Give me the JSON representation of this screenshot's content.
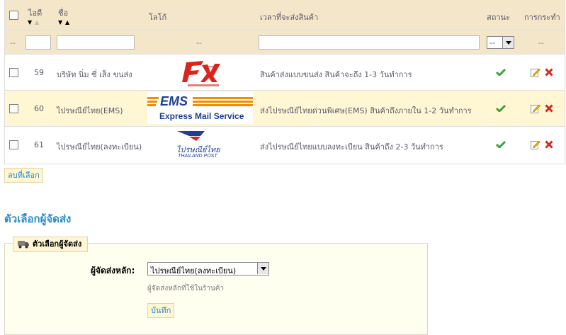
{
  "table": {
    "headers": {
      "id": "ไอดี",
      "name": "ชื่อ",
      "logo": "โลโก้",
      "delay": "เวลาที่จะส่งสินค้า",
      "status": "สถานะ",
      "actions": "การกระทำ"
    },
    "filter": {
      "first_dash": "--",
      "logo_dash": "--",
      "status_select": "--",
      "actions_dash": "--"
    },
    "rows": [
      {
        "id": "59",
        "name": "บริษัท นิ่ม ซี่ เส็ง ขนส่ง",
        "logo": "nim-see-seng-logo",
        "delay": "สินค้าส่งแบบขนส่ง สินค้าจะถึง 1-3 วันทำการ",
        "status": "active"
      },
      {
        "id": "60",
        "name": "ไปรษณีย์ไทย(EMS)",
        "logo_text_top": "EMS",
        "logo_text_bottom": "Express Mail Service",
        "delay": "ส่งไปรษณีย์ไทยด่วนพิเศษ(EMS) สินค้าถึงภายใน 1-2 วันทำการ",
        "status": "active"
      },
      {
        "id": "61",
        "name": "ไปรษณีย์ไทย(ลงทะเบียน)",
        "logo_text_top": "ไปรษณีย์ไทย",
        "logo_text_bottom": "THAILAND POST",
        "delay": "ส่งไปรษณีย์ไทยแบบลงทะเบียน สินค้าถึง 2-3 วันทำการ",
        "status": "active"
      }
    ],
    "delete_selected": "ลบที่เลือก"
  },
  "options": {
    "section_title": "ตัวเลือกผู้จัดส่ง",
    "legend": "ตัวเลือกผู้จัดส่ง",
    "default_carrier_label": "ผู้จัดส่งหลัก:",
    "default_carrier_value": "ไปรษณีย์ไทย(ลงทะเบียน)",
    "hint": "ผู้จัดส่งหลักที่ใช้ในร้านค้า",
    "save": "บันทึก"
  },
  "colors": {
    "header_bg": "#f4e6c9",
    "highlight_row": "#fff6d3",
    "link_blue": "#268ccd",
    "check_green": "#3fa33f",
    "delete_red": "#d9251d"
  }
}
